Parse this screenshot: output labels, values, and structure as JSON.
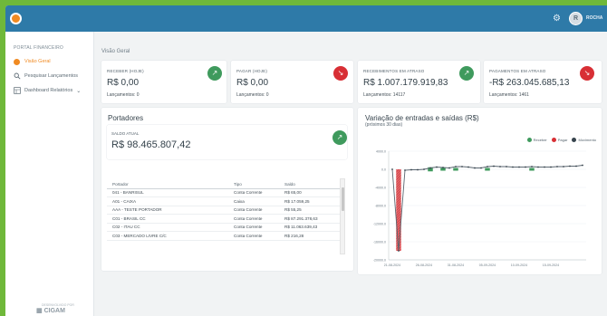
{
  "header": {
    "username": "ROCHA",
    "avatar_initial": "R",
    "icons": {
      "settings": "gear-icon",
      "logo": "logo-icon"
    }
  },
  "sidebar": {
    "section": "PORTAL FINANCEIRO",
    "items": [
      {
        "label": "Visão Geral",
        "icon": "dashboard-dot-icon",
        "active": true
      },
      {
        "label": "Pesquisar Lançamentos",
        "icon": "search-icon",
        "active": false
      },
      {
        "label": "Dashboard Relatórios",
        "icon": "report-icon",
        "active": false
      }
    ],
    "footer_brand": "CIGAM",
    "footer_sub": "DESENVOLVIDO POR"
  },
  "breadcrumb": "Visão Geral",
  "kpis": [
    {
      "label": "RECEBER (HOJE)",
      "value": "R$ 0,00",
      "sub": "Lançamentos: 0",
      "trend": "up",
      "color": "#3f9a5d"
    },
    {
      "label": "PAGAR (HOJE)",
      "value": "R$ 0,00",
      "sub": "Lançamentos: 0",
      "trend": "down",
      "color": "#d82f35"
    },
    {
      "label": "RECEBIMENTOS EM ATRASO",
      "value": "R$ 1.007.179.919,83",
      "sub": "Lançamentos: 14117",
      "trend": "up",
      "color": "#3f9a5d"
    },
    {
      "label": "PAGAMENTOS EM ATRASO",
      "value": "-R$ 263.045.685,13",
      "sub": "Lançamentos: 1461",
      "trend": "down",
      "color": "#d82f35"
    }
  ],
  "portadores": {
    "title": "Portadores",
    "saldo_label": "SALDO ATUAL",
    "saldo_value": "R$ 98.465.807,42",
    "columns": [
      "Portador",
      "Tipo",
      "Saldo"
    ],
    "rows": [
      [
        "041 - BANRISUL",
        "Conta Corrente",
        "R$ 65,00"
      ],
      [
        "A01 - CAIXA",
        "Caixa",
        "R$ 17.059,25"
      ],
      [
        "AAA - TESTE PORTADOR",
        "Conta Corrente",
        "R$ 55,25"
      ],
      [
        "C01 - BRASIL CC",
        "Conta Corrente",
        "R$ 87.291.378,63"
      ],
      [
        "C02 - ITAU CC",
        "Conta Corrente",
        "R$ 11.063.639,43"
      ],
      [
        "C03 - MERCADO LIVRE C/C",
        "Conta Corrente",
        "R$ 216,28"
      ]
    ]
  },
  "chart_data": {
    "type": "bar",
    "title": "Variação de entradas e saídas (R$)",
    "subtitle": "(próximos 30 dias)",
    "legend": [
      "Receber",
      "Pagar",
      "Movimento"
    ],
    "colors": {
      "Receber": "#3f9a5d",
      "Pagar": "#d82f35",
      "Movimento": "#37444d"
    },
    "legend_position": "top-right",
    "x": [
      "21-08-2024",
      "22-08-2024",
      "23-08-2024",
      "24-08-2024",
      "25-08-2024",
      "26-08-2024",
      "27-08-2024",
      "28-08-2024",
      "29-08-2024",
      "30-08-2024",
      "31-08-2024",
      "01-09-2024",
      "02-09-2024",
      "03-09-2024",
      "04-09-2024",
      "05-09-2024",
      "06-09-2024",
      "07-09-2024",
      "08-09-2024",
      "09-09-2024",
      "10-09-2024",
      "11-09-2024",
      "12-09-2024",
      "13-09-2024",
      "14-09-2024",
      "15-09-2024",
      "16-09-2024",
      "17-09-2024",
      "18-09-2024",
      "19-09-2024",
      "20-09-2024"
    ],
    "x_tick_labels": [
      "21-08-2024",
      "26-08-2024",
      "31-08-2024",
      "05-09-2024",
      "10-09-2024",
      "15-09-2024"
    ],
    "x_tick_index": [
      0,
      5,
      10,
      15,
      20,
      25
    ],
    "y_tick_labels": [
      "4000.0",
      "0.0",
      "-4000.0",
      "-8000.0",
      "-12000.0",
      "-16000.0",
      "-20000.0"
    ],
    "ylim": [
      -20000,
      4000
    ],
    "series": [
      {
        "name": "Receber",
        "values": [
          0,
          0,
          0,
          0,
          0,
          0,
          900,
          0,
          600,
          0,
          500,
          0,
          0,
          0,
          0,
          600,
          0,
          0,
          0,
          0,
          0,
          0,
          600,
          0,
          0,
          0,
          0,
          0,
          0,
          0,
          0
        ]
      },
      {
        "name": "Pagar",
        "values": [
          0,
          -18000,
          0,
          0,
          0,
          0,
          0,
          0,
          0,
          0,
          0,
          0,
          0,
          0,
          0,
          0,
          0,
          0,
          0,
          0,
          0,
          0,
          0,
          0,
          0,
          0,
          0,
          0,
          0,
          0,
          0
        ]
      },
      {
        "name": "Movimento",
        "values": [
          0,
          -18000,
          -200,
          -100,
          -100,
          0,
          300,
          500,
          400,
          300,
          600,
          600,
          500,
          300,
          300,
          600,
          700,
          600,
          600,
          500,
          500,
          500,
          600,
          500,
          500,
          500,
          600,
          600,
          700,
          700,
          900
        ]
      }
    ]
  }
}
